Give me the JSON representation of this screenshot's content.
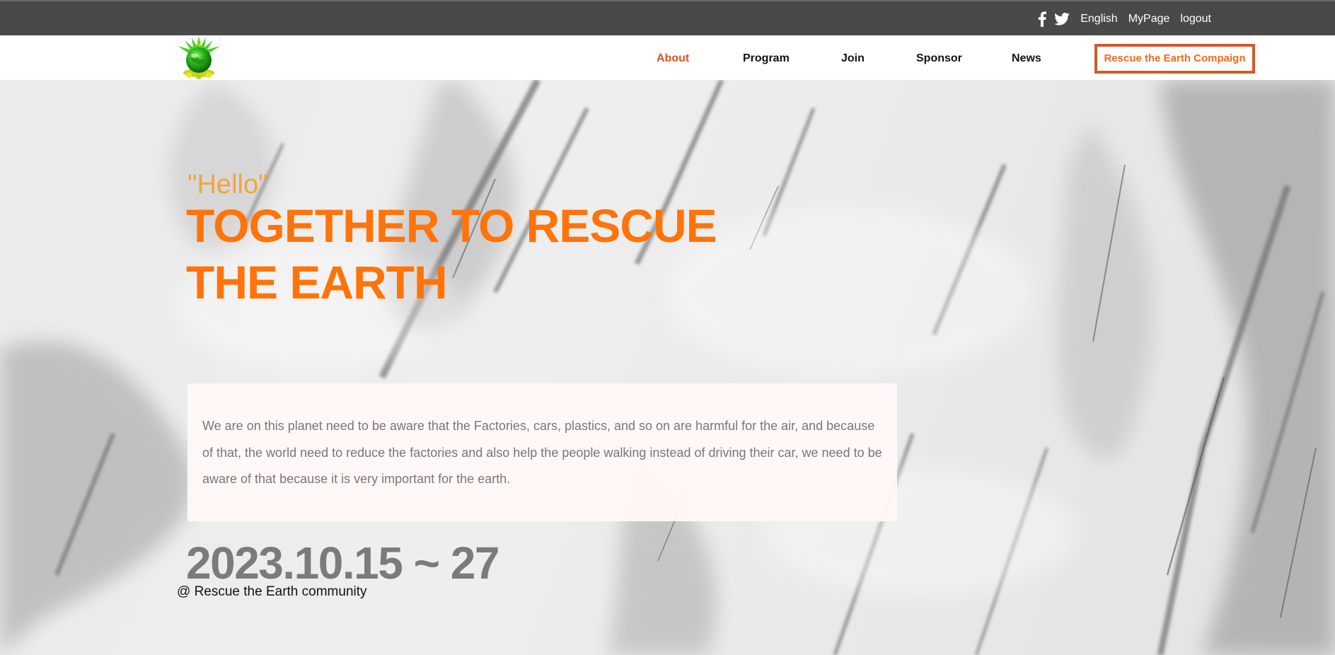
{
  "topbar": {
    "social": {
      "facebook_icon": "facebook-icon",
      "twitter_icon": "twitter-icon"
    },
    "language": "English",
    "mypage": "MyPage",
    "logout": "logout"
  },
  "nav": {
    "logo_icon": "globe-logo",
    "items": [
      {
        "label": "About",
        "active": true
      },
      {
        "label": "Program",
        "active": false
      },
      {
        "label": "Join",
        "active": false
      },
      {
        "label": "Sponsor",
        "active": false
      },
      {
        "label": "News",
        "active": false
      }
    ],
    "cta_label": "Rescue the Earth Compaign"
  },
  "hero": {
    "hello": "\"Hello\"",
    "headline_line1": "TOGETHER TO RESCUE",
    "headline_line2": "THE EARTH",
    "intro": "We are on this planet need to be aware that the Factories, cars, plastics, and so on are harmful for the air, and because of that, the world need to reduce the factories and also help the people walking instead of driving their car, we need to be aware of that because it is very important for the earth.",
    "date_range": "2023.10.15 ~ 27",
    "organizer": "@ Rescue the Earth community"
  },
  "colors": {
    "topbar_bg": "#4a4949",
    "accent_orange": "#ff740a",
    "active_nav": "#d7561d",
    "cta_border": "#cf5a28",
    "hello_color": "#f5a33a",
    "date_color": "#7b7b7b"
  }
}
